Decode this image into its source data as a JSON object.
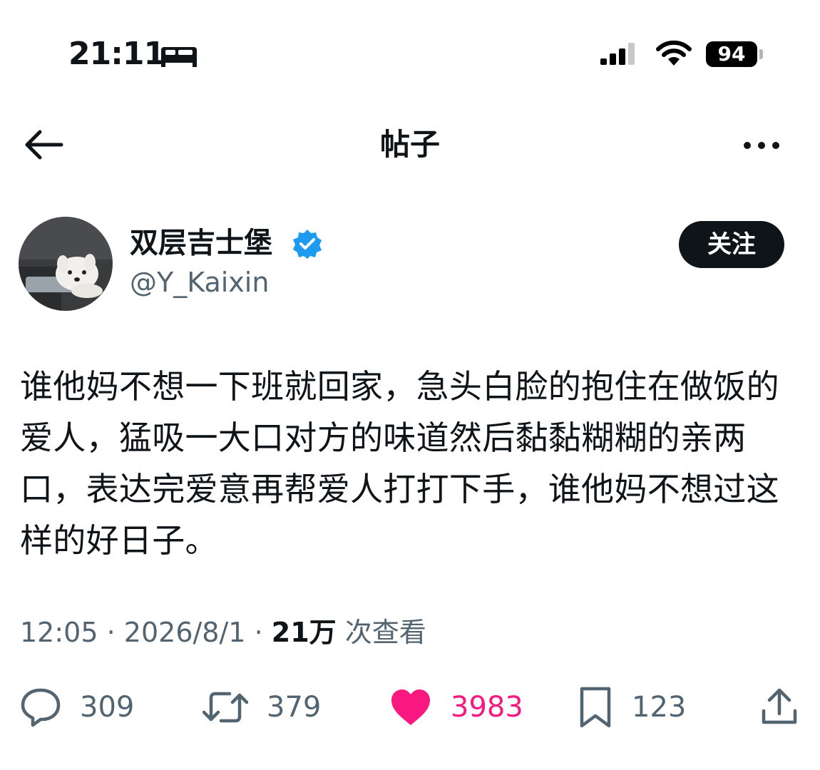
{
  "status_bar": {
    "time": "21:11",
    "battery": "94",
    "icons": [
      "bed-icon",
      "cellular-signal-icon",
      "wifi-icon",
      "battery-icon"
    ]
  },
  "nav": {
    "title": "帖子",
    "back_icon": "arrow-left-icon",
    "more_icon": "more-horizontal-icon"
  },
  "author": {
    "display_name": "双层吉士堡",
    "handle": "@Y_Kaixin",
    "verified": true,
    "avatar_icon": "dog-photo-avatar"
  },
  "follow_label": "关注",
  "post": {
    "text": "谁他妈不想一下班就回家，急头白脸的抱住在做饭的爱人，猛吸一大口对方的味道然后黏黏糊糊的亲两口，表达完爱意再帮爱人打打下手，谁他妈不想过这样的好日子。",
    "time": "12:05",
    "date": "2026/8/1",
    "separator": "·",
    "views_count": "21万",
    "views_label": "次查看"
  },
  "actions": {
    "replies": "309",
    "reposts": "379",
    "likes": "3983",
    "bookmarks": "123",
    "liked": true,
    "like_color": "#f91880",
    "text_color": "#536471"
  }
}
